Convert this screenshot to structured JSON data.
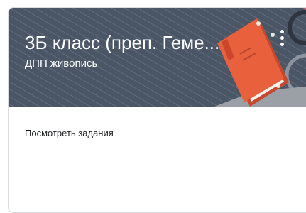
{
  "class_card": {
    "title": "3Б класс (преп. Геме...",
    "subtitle": "ДПП живопись",
    "more_icon": "more-vert-icon",
    "header_color": "#4a5666",
    "book_color": "#e8603c",
    "view_assignments_label": "Посмотреть задания"
  }
}
